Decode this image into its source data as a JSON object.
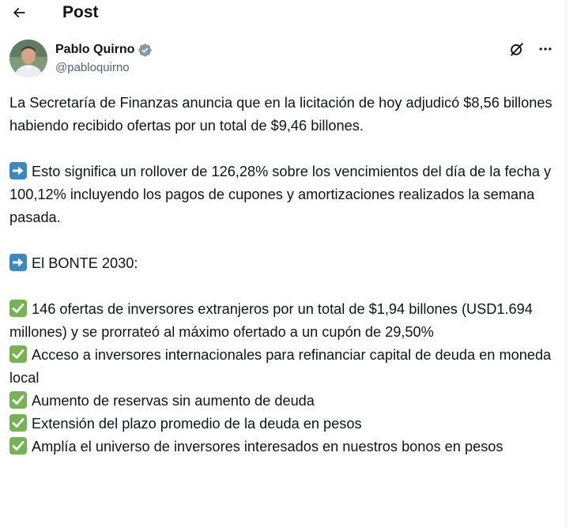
{
  "header": {
    "title": "Post",
    "back_icon": "arrow-left-icon"
  },
  "author": {
    "display_name": "Pablo Quirno",
    "handle": "@pabloquirno",
    "verified_icon": "verified-badge-icon",
    "verified_color": "#829aab",
    "actions": [
      "grok-icon",
      "more-icon"
    ]
  },
  "post": {
    "intro": "La Secretaría de Finanzas anuncia que en la licitación de hoy adjudicó $8,56 billones habiendo recibido ofertas por un total de $9,46 billones.",
    "rollover": "Esto significa un rollover de 126,28% sobre los vencimientos del día de la fecha y 100,12% incluyendo los pagos de cupones y amortizaciones realizados la semana pasada.",
    "bonte_heading": "El BONTE 2030:",
    "bullets": [
      "146 ofertas de inversores extranjeros por un total de $1,94 billones (USD1.694 millones) y se prorrateó al máximo ofertado a un cupón de 29,50%",
      "Acceso a inversores internacionales para refinanciar capital de deuda en moneda local",
      "Aumento de reservas sin aumento de deuda",
      "Extensión del plazo promedio de la deuda en pesos",
      "Amplía el universo de inversores interesados en nuestros bonos en pesos"
    ]
  },
  "colors": {
    "text": "#0f1419",
    "muted": "#536471",
    "arrow_emoji_bg": "#3b88c3",
    "check_emoji_bg": "#77b255"
  }
}
